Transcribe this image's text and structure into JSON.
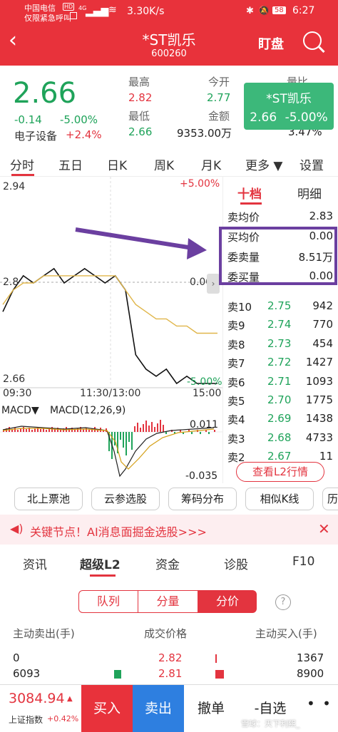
{
  "status": {
    "carrier": "中国电信",
    "carrier_badge": "HD",
    "emergency": "仅限紧急呼叫",
    "net": "4G",
    "speed": "3.30K/s",
    "battery": "58",
    "time": "6:27"
  },
  "nav": {
    "title": "*ST凯乐",
    "code": "600260",
    "watch_label": "盯盘"
  },
  "quote": {
    "price": "2.66",
    "change": "-0.14",
    "change_pct": "-5.00%",
    "sector": "电子设备",
    "sector_pct": "+2.4%",
    "high_label": "最高",
    "high": "2.82",
    "low_label": "最低",
    "low": "2.66",
    "open_label": "今开",
    "open": "2.77",
    "amount_label": "金额",
    "amount": "9353.00万",
    "extra_label": "量比",
    "extra_value": "3.47%",
    "popup_name": "*ST凯乐",
    "popup_price": "2.66",
    "popup_pct": "-5.00%"
  },
  "tabs": [
    "分时",
    "五日",
    "日K",
    "周K",
    "月K",
    "更多 ▼",
    "设置"
  ],
  "chart": {
    "y_top": "2.94",
    "y_mid": "2.8",
    "y_bottom": "2.66",
    "pct_top": "+5.00%",
    "pct_mid": "0.00%",
    "pct_bottom": "-5.00%",
    "x_start": "09:30",
    "x_mid": "11:30/13:00",
    "x_end": "15:00",
    "macd_label": "MACD▼",
    "macd_params": "MACD(12,26,9)",
    "macd_top": "0.011",
    "macd_bottom": "-0.035"
  },
  "chart_data": {
    "type": "line",
    "series": [
      {
        "values": [
          2.76,
          2.79,
          2.81,
          2.8,
          2.81,
          2.82,
          2.8,
          2.81,
          2.82,
          2.81,
          2.8,
          2.81,
          2.79,
          2.7,
          2.68,
          2.67,
          2.68,
          2.66,
          2.67,
          2.66,
          2.66,
          2.66
        ]
      },
      {
        "values": [
          2.77,
          2.79,
          2.8,
          2.8,
          2.81,
          2.81,
          2.81,
          2.81,
          2.81,
          2.81,
          2.81,
          2.81,
          2.79,
          2.77,
          2.76,
          2.75,
          2.75,
          2.74,
          2.74,
          2.73,
          2.73,
          2.73
        ]
      }
    ],
    "ylim": [
      2.66,
      2.94
    ]
  },
  "orderbook": {
    "tab_active": "十档",
    "tab_other": "明细",
    "summary": [
      {
        "label": "卖均价",
        "value": "2.83"
      },
      {
        "label": "买均价",
        "value": "0.00"
      },
      {
        "label": "委卖量",
        "value": "8.51万"
      },
      {
        "label": "委买量",
        "value": "0.00"
      }
    ],
    "asks": [
      {
        "label": "卖10",
        "price": "2.75",
        "vol": "942"
      },
      {
        "label": "卖9",
        "price": "2.74",
        "vol": "770"
      },
      {
        "label": "卖8",
        "price": "2.73",
        "vol": "454"
      },
      {
        "label": "卖7",
        "price": "2.72",
        "vol": "1427"
      },
      {
        "label": "卖6",
        "price": "2.71",
        "vol": "1093"
      },
      {
        "label": "卖5",
        "price": "2.70",
        "vol": "1775"
      },
      {
        "label": "卖4",
        "price": "2.69",
        "vol": "1438"
      },
      {
        "label": "卖3",
        "price": "2.68",
        "vol": "4733"
      },
      {
        "label": "卖2",
        "price": "2.67",
        "vol": "11"
      }
    ],
    "l2_button": "查看L2行情"
  },
  "chips": [
    "北上票池",
    "云参选股",
    "筹码分布",
    "相似K线",
    "历"
  ],
  "banner": "关键节点！AI消息面掘金选股>>>",
  "subtabs": [
    "资讯",
    "超级L2",
    "资金",
    "诊股",
    "F10"
  ],
  "segments": [
    "队列",
    "分量",
    "分价"
  ],
  "list": {
    "headers": [
      "主动卖出(手)",
      "成交价格",
      "主动买入(手)"
    ],
    "rows": [
      {
        "sell": "0",
        "price": "2.82",
        "buy": "1367"
      },
      {
        "sell": "6093",
        "price": "2.81",
        "buy": "8900"
      }
    ]
  },
  "bottom": {
    "index_value": "3084.94",
    "index_name": "上证指数",
    "index_pct": "+0.42%",
    "buy": "买入",
    "sell": "卖出",
    "cancel": "撤单",
    "watch": "-自选",
    "watermark": "雪球：天下利熙_"
  },
  "colors": {
    "header_red": "#e8323b",
    "rise": "#e3343f",
    "fall": "#1fa35a",
    "highlight_purple": "#6b3fa0"
  }
}
